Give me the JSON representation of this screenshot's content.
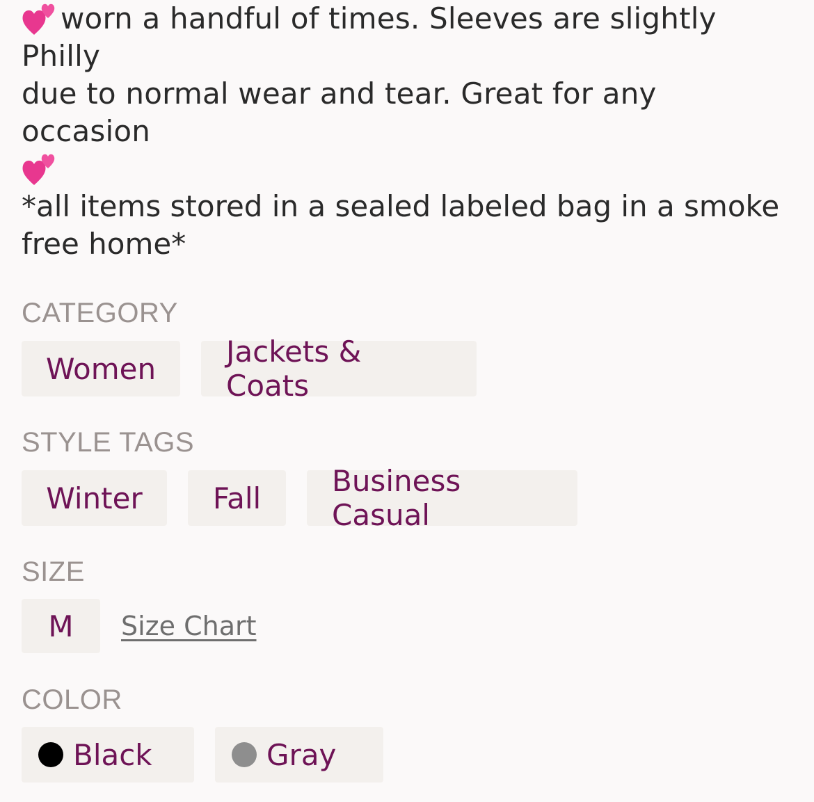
{
  "description": {
    "line1": "worn a handful of times. Sleeves are slightly Philly",
    "line2": "due to normal wear and tear. Great for any occasion",
    "emoji_icon": "two-hearts-icon"
  },
  "note": "*all items stored in a sealed labeled bag in a smoke free home*",
  "category": {
    "label": "CATEGORY",
    "items": [
      "Women",
      "Jackets & Coats"
    ]
  },
  "style_tags": {
    "label": "STYLE TAGS",
    "items": [
      "Winter",
      "Fall",
      "Business Casual"
    ]
  },
  "size": {
    "label": "SIZE",
    "value": "M",
    "chart_link": "Size Chart"
  },
  "color": {
    "label": "COLOR",
    "items": [
      {
        "name": "Black",
        "swatch": "#000000"
      },
      {
        "name": "Gray",
        "swatch": "#8e8e8e"
      }
    ]
  },
  "colors": {
    "accent": "#6e1356",
    "chip_bg": "#f3f0ed",
    "label": "#9a9290"
  }
}
